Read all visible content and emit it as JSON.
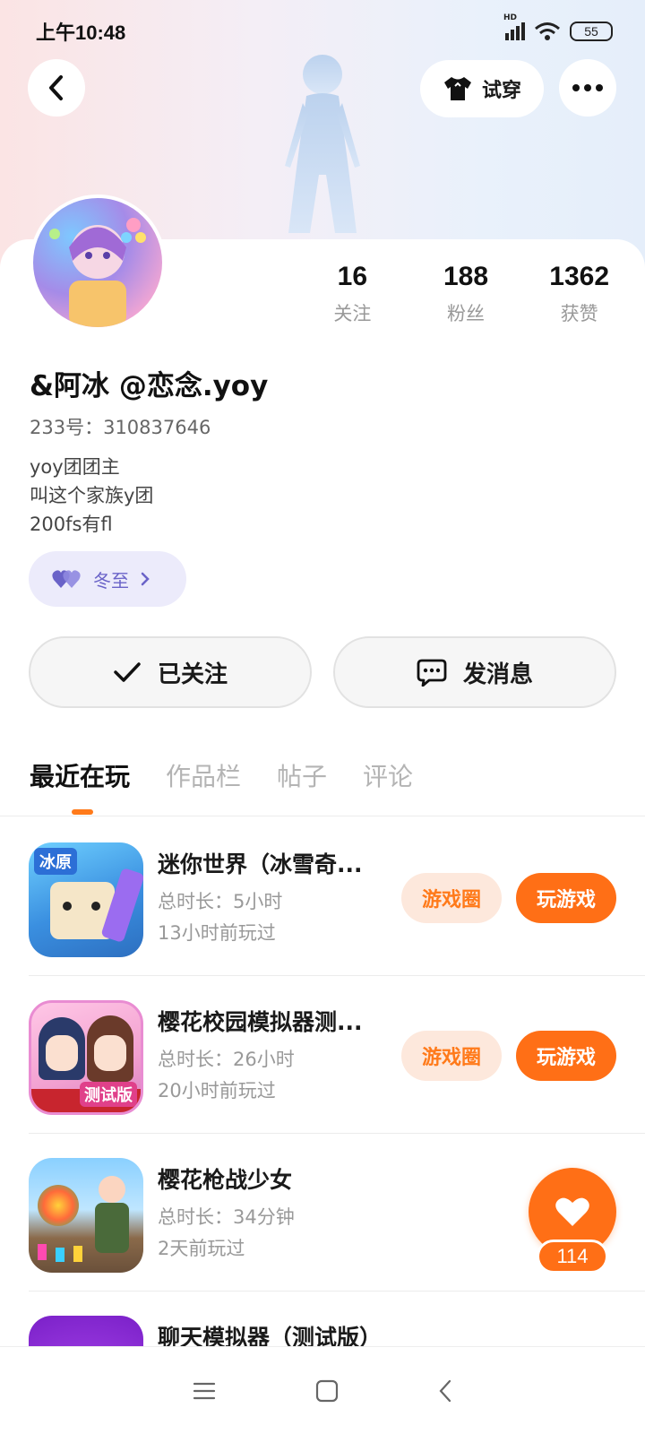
{
  "status_bar": {
    "time": "上午10:48",
    "network": "HD",
    "battery": "55"
  },
  "header": {
    "try_on_label": "试穿"
  },
  "profile": {
    "stats": [
      {
        "value": "16",
        "label": "关注"
      },
      {
        "value": "188",
        "label": "粉丝"
      },
      {
        "value": "1362",
        "label": "获赞"
      }
    ],
    "nickname": "&阿冰 @恋念.yoy",
    "uid": "233号：310837646",
    "bio": [
      "yoy团团主",
      "叫这个家族y团",
      "200fs有fl"
    ],
    "family_chip": "冬至",
    "follow_label": "已关注",
    "message_label": "发消息"
  },
  "tabs": [
    {
      "label": "最近在玩",
      "active": true
    },
    {
      "label": "作品栏",
      "active": false
    },
    {
      "label": "帖子",
      "active": false
    },
    {
      "label": "评论",
      "active": false
    }
  ],
  "games": [
    {
      "title": "迷你世界（冰雪奇...",
      "duration": "总时长：5小时",
      "last_played": "13小时前玩过",
      "circle_label": "游戏圈",
      "play_label": "玩游戏",
      "icon_badge": "冰原"
    },
    {
      "title": "樱花校园模拟器测...",
      "duration": "总时长：26小时",
      "last_played": "20小时前玩过",
      "circle_label": "游戏圈",
      "play_label": "玩游戏",
      "icon_badge": "测试版"
    },
    {
      "title": "樱花枪战少女",
      "duration": "总时长：34分钟",
      "last_played": "2天前玩过",
      "circle_label": "",
      "play_label": ""
    },
    {
      "title": "聊天模拟器（测试版）",
      "duration": "",
      "last_played": "",
      "circle_label": "",
      "play_label": ""
    }
  ],
  "like": {
    "count": "114"
  },
  "colors": {
    "accent": "#ff6f16",
    "accent_light": "#fde8dc",
    "chip_bg": "#ecebfb",
    "chip_text": "#6a63c8"
  }
}
